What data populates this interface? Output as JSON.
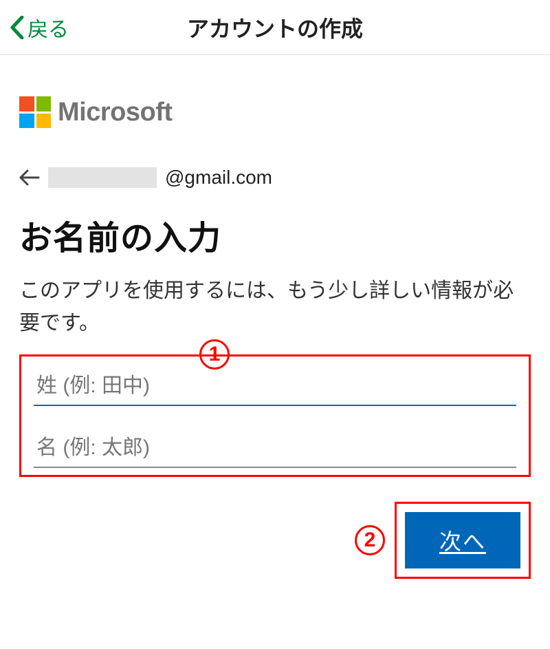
{
  "topbar": {
    "back_label": "戻る",
    "title": "アカウントの作成"
  },
  "brand": {
    "name": "Microsoft"
  },
  "email": {
    "domain": "@gmail.com"
  },
  "page": {
    "heading": "お名前の入力",
    "description": "このアプリを使用するには、もう少し詳しい情報が必要です。"
  },
  "form": {
    "last_name_placeholder": "姓 (例: 田中)",
    "first_name_placeholder": "名 (例: 太郎)",
    "last_name_value": "",
    "first_name_value": "",
    "next_label": "次へ"
  },
  "annotations": {
    "a1": "1",
    "a2": "2"
  }
}
